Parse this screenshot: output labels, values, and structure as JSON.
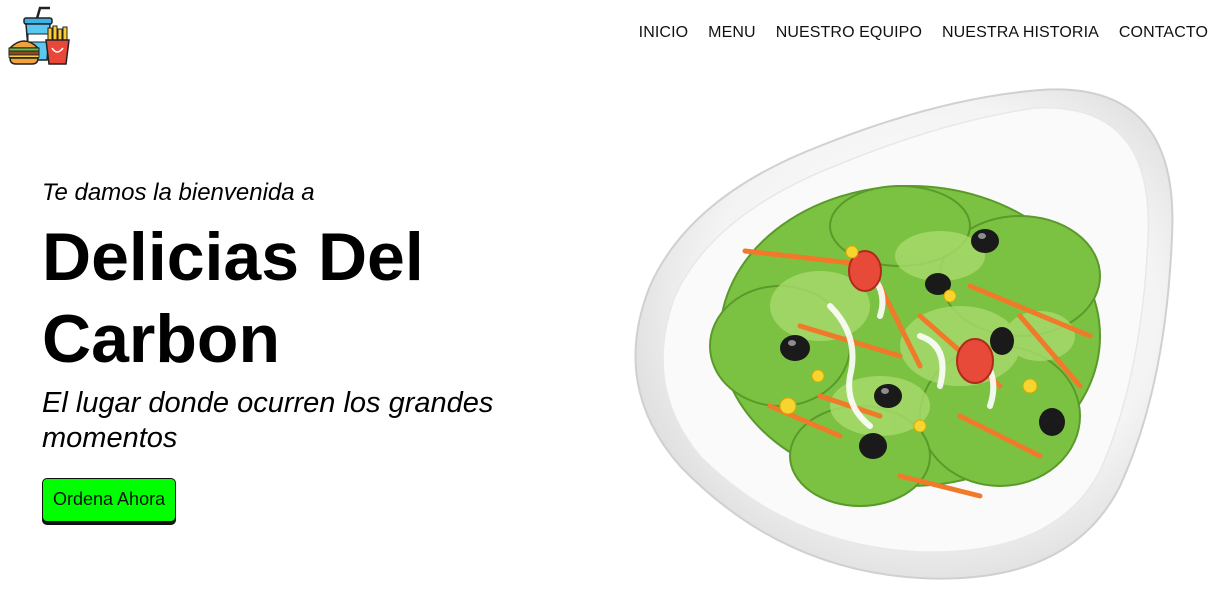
{
  "header": {
    "logo_icon": "fast-food-combo-icon",
    "nav": [
      {
        "label": "INICIO"
      },
      {
        "label": "MENU"
      },
      {
        "label": "NUESTRO EQUIPO"
      },
      {
        "label": "NUESTRA HISTORIA"
      },
      {
        "label": "CONTACTO"
      }
    ]
  },
  "hero": {
    "welcome": "Te damos la bienvenida a",
    "brand": "Delicias Del Carbon",
    "tagline": "El lugar donde ocurren los grandes momentos",
    "cta_label": "Ordena Ahora",
    "cta_color": "#00ff00"
  },
  "image": {
    "subject": "salad-plate-image"
  }
}
